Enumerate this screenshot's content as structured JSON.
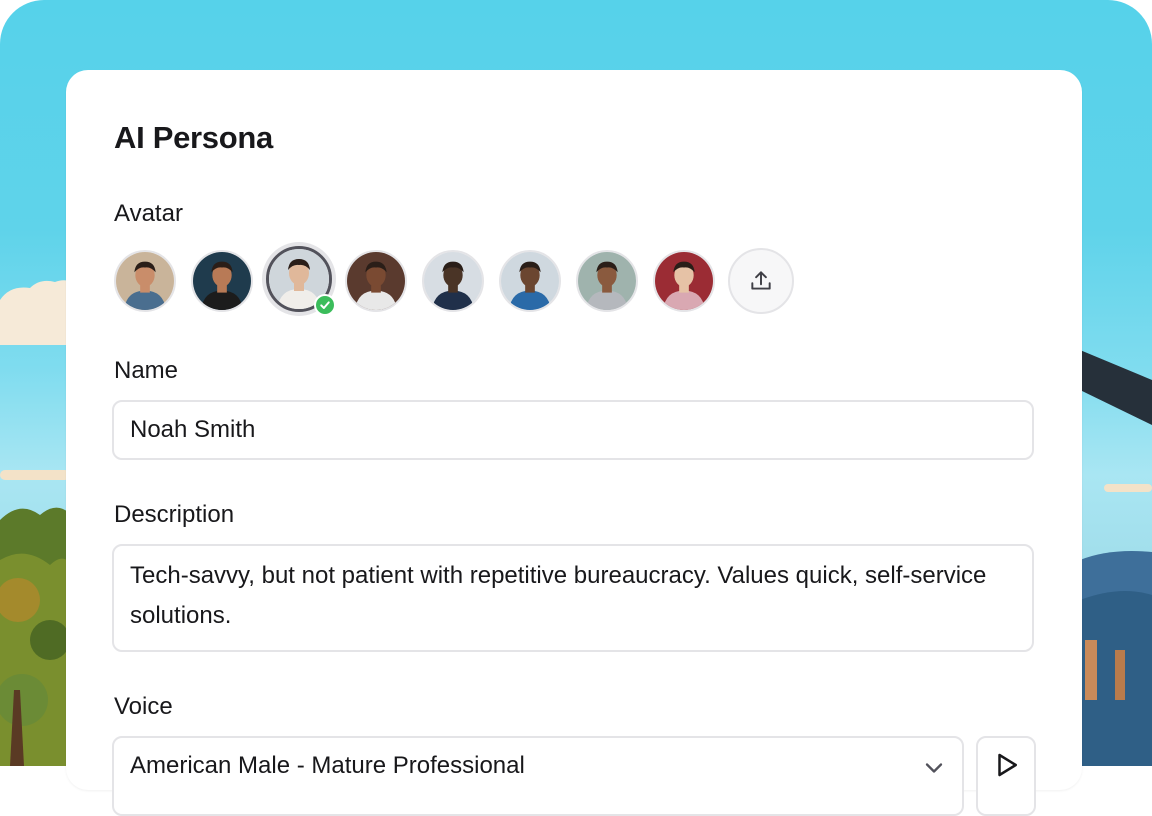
{
  "card": {
    "title": "AI Persona"
  },
  "avatar_section": {
    "label": "Avatar",
    "avatars": [
      {
        "name": "avatar-1",
        "bg": "#c9b49a",
        "skin": "#c98d6a",
        "shirt": "#4a6e8f"
      },
      {
        "name": "avatar-2",
        "bg": "#1f3b4d",
        "skin": "#b87a56",
        "shirt": "#1c1c1c"
      },
      {
        "name": "avatar-3",
        "bg": "#cfd6db",
        "skin": "#e0b89a",
        "shirt": "#f0eeea",
        "selected": true
      },
      {
        "name": "avatar-4",
        "bg": "#5a3a2e",
        "skin": "#7a4a32",
        "shirt": "#e8e8e8"
      },
      {
        "name": "avatar-5",
        "bg": "#d7dde3",
        "skin": "#4a3426",
        "shirt": "#20304a"
      },
      {
        "name": "avatar-6",
        "bg": "#cfd8df",
        "skin": "#6b4630",
        "shirt": "#2a6aa8"
      },
      {
        "name": "avatar-7",
        "bg": "#9fb3ad",
        "skin": "#8a5a3e",
        "shirt": "#b5b8bd"
      },
      {
        "name": "avatar-8",
        "bg": "#9b2c34",
        "skin": "#e6c2a6",
        "shirt": "#d9a8b2"
      }
    ],
    "upload_icon": "upload-icon"
  },
  "name_section": {
    "label": "Name",
    "value": "Noah Smith"
  },
  "description_section": {
    "label": "Description",
    "value": "Tech-savvy, but not patient with repetitive bureaucracy. Values quick, self-service solutions."
  },
  "voice_section": {
    "label": "Voice",
    "value": "American Male - Mature Professional",
    "dropdown_icon": "chevron-down-icon",
    "play_icon": "play-icon"
  },
  "colors": {
    "check_badge": "#3bbd5b",
    "sky": "#56d2ea",
    "text": "#18181b",
    "border": "#e4e4e7"
  }
}
